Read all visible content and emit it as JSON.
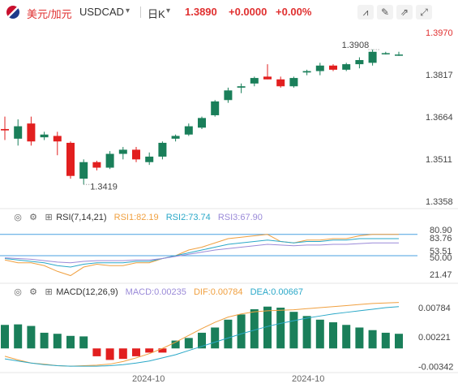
{
  "header": {
    "symbol_cn": "美元/加元",
    "symbol_en": "USDCAD",
    "timeframe": "日K",
    "price": "1.3890",
    "change": "+0.0000",
    "change_pct": "+0.00%",
    "tools": [
      "chart-type-icon",
      "draw-icon",
      "indicator-icon",
      "fullscreen-icon"
    ]
  },
  "chart_data": [
    {
      "type": "candlestick",
      "title": "USDCAD",
      "ylim": [
        1.3358,
        1.397
      ],
      "yticks": [
        "1.3970",
        "1.3817",
        "1.3664",
        "1.3511",
        "1.3358"
      ],
      "annotations": [
        "1.3908",
        "1.3419"
      ],
      "xticks": [
        "2024-10",
        "2024-10"
      ],
      "up_color": "#1a7f5a",
      "down_color": "#e21f1f",
      "candles": [
        {
          "o": 1.362,
          "h": 1.3665,
          "l": 1.358,
          "c": 1.3615,
          "u": false
        },
        {
          "o": 1.3585,
          "h": 1.3655,
          "l": 1.356,
          "c": 1.363,
          "u": true
        },
        {
          "o": 1.364,
          "h": 1.3665,
          "l": 1.356,
          "c": 1.3575,
          "u": false
        },
        {
          "o": 1.359,
          "h": 1.361,
          "l": 1.358,
          "c": 1.36,
          "u": true
        },
        {
          "o": 1.3595,
          "h": 1.361,
          "l": 1.3525,
          "c": 1.3575,
          "u": false
        },
        {
          "o": 1.357,
          "h": 1.3575,
          "l": 1.344,
          "c": 1.345,
          "u": false
        },
        {
          "o": 1.344,
          "h": 1.351,
          "l": 1.3419,
          "c": 1.35,
          "u": true
        },
        {
          "o": 1.35,
          "h": 1.3505,
          "l": 1.347,
          "c": 1.348,
          "u": false
        },
        {
          "o": 1.348,
          "h": 1.354,
          "l": 1.3475,
          "c": 1.353,
          "u": true
        },
        {
          "o": 1.353,
          "h": 1.3555,
          "l": 1.351,
          "c": 1.3545,
          "u": true
        },
        {
          "o": 1.3545,
          "h": 1.3555,
          "l": 1.35,
          "c": 1.351,
          "u": false
        },
        {
          "o": 1.35,
          "h": 1.3535,
          "l": 1.349,
          "c": 1.352,
          "u": true
        },
        {
          "o": 1.352,
          "h": 1.3575,
          "l": 1.351,
          "c": 1.357,
          "u": true
        },
        {
          "o": 1.3585,
          "h": 1.36,
          "l": 1.3575,
          "c": 1.3595,
          "u": true
        },
        {
          "o": 1.36,
          "h": 1.364,
          "l": 1.3595,
          "c": 1.363,
          "u": true
        },
        {
          "o": 1.3625,
          "h": 1.3665,
          "l": 1.362,
          "c": 1.366,
          "u": true
        },
        {
          "o": 1.367,
          "h": 1.3725,
          "l": 1.3665,
          "c": 1.372,
          "u": true
        },
        {
          "o": 1.3725,
          "h": 1.377,
          "l": 1.3715,
          "c": 1.376,
          "u": true
        },
        {
          "o": 1.377,
          "h": 1.3785,
          "l": 1.375,
          "c": 1.3775,
          "u": true
        },
        {
          "o": 1.3785,
          "h": 1.381,
          "l": 1.3775,
          "c": 1.3805,
          "u": true
        },
        {
          "o": 1.381,
          "h": 1.3855,
          "l": 1.38,
          "c": 1.38,
          "u": false
        },
        {
          "o": 1.38,
          "h": 1.381,
          "l": 1.377,
          "c": 1.3775,
          "u": false
        },
        {
          "o": 1.3775,
          "h": 1.381,
          "l": 1.377,
          "c": 1.3805,
          "u": true
        },
        {
          "o": 1.3825,
          "h": 1.3835,
          "l": 1.3815,
          "c": 1.383,
          "u": true
        },
        {
          "o": 1.383,
          "h": 1.386,
          "l": 1.3815,
          "c": 1.385,
          "u": true
        },
        {
          "o": 1.385,
          "h": 1.3855,
          "l": 1.383,
          "c": 1.3835,
          "u": false
        },
        {
          "o": 1.3835,
          "h": 1.386,
          "l": 1.383,
          "c": 1.3855,
          "u": true
        },
        {
          "o": 1.3855,
          "h": 1.388,
          "l": 1.384,
          "c": 1.387,
          "u": true
        },
        {
          "o": 1.386,
          "h": 1.3908,
          "l": 1.385,
          "c": 1.39,
          "u": true
        },
        {
          "o": 1.3895,
          "h": 1.39,
          "l": 1.389,
          "c": 1.3895,
          "u": true
        },
        {
          "o": 1.389,
          "h": 1.39,
          "l": 1.3885,
          "c": 1.389,
          "u": true
        }
      ]
    },
    {
      "type": "line",
      "title": "RSI(7,14,21)",
      "ylim": [
        21.47,
        80.9
      ],
      "yticks": [
        "80.90",
        "83.76",
        "53.51",
        "50.00",
        "21.47"
      ],
      "series": [
        {
          "name": "RSI1:82.19",
          "color": "#f0a040",
          "values": [
            44,
            40,
            40,
            36,
            28,
            22,
            34,
            38,
            36,
            36,
            40,
            40,
            46,
            50,
            58,
            62,
            68,
            74,
            76,
            78,
            80,
            70,
            68,
            72,
            72,
            74,
            74,
            78,
            80,
            80,
            80
          ]
        },
        {
          "name": "RSI2:73.74",
          "color": "#2aa8c8",
          "values": [
            46,
            44,
            42,
            40,
            36,
            34,
            38,
            40,
            40,
            40,
            42,
            42,
            46,
            50,
            54,
            58,
            62,
            66,
            68,
            70,
            72,
            70,
            68,
            70,
            70,
            72,
            72,
            74,
            74,
            74,
            74
          ]
        },
        {
          "name": "RSI3:67.90",
          "color": "#9a8ad8",
          "values": [
            47,
            46,
            45,
            43,
            41,
            40,
            42,
            43,
            43,
            43,
            44,
            44,
            46,
            49,
            52,
            55,
            58,
            60,
            62,
            64,
            66,
            65,
            64,
            65,
            65,
            66,
            66,
            67,
            68,
            68,
            68
          ]
        }
      ],
      "ref_lines": [
        80,
        50
      ]
    },
    {
      "type": "bar",
      "title": "MACD(12,26,9)",
      "ylim": [
        -0.00342,
        0.00784
      ],
      "yticks": [
        "0.00784",
        "0.00221",
        "-0.00342"
      ],
      "series": [
        {
          "name": "MACD:0.00235",
          "color": "#1a7f5a",
          "values": [
            0.0045,
            0.0046,
            0.0043,
            0.003,
            0.0028,
            0.0024,
            0.0023,
            -0.0015,
            -0.0022,
            -0.002,
            -0.0015,
            -0.0008,
            -0.0008,
            0.0015,
            0.002,
            0.003,
            0.004,
            0.0055,
            0.0065,
            0.0075,
            0.008,
            0.0078,
            0.007,
            0.0062,
            0.0055,
            0.005,
            0.0045,
            0.004,
            0.0035,
            0.003,
            0.0028
          ]
        },
        {
          "name": "DIF:0.00784",
          "color": "#f0a040",
          "values": [
            -0.0015,
            -0.0022,
            -0.0028,
            -0.003,
            -0.0033,
            -0.0034,
            -0.0033,
            -0.0032,
            -0.003,
            -0.0025,
            -0.0018,
            -0.001,
            0.0,
            0.0012,
            0.0025,
            0.0038,
            0.005,
            0.006,
            0.0066,
            0.007,
            0.0072,
            0.0073,
            0.0074,
            0.0076,
            0.0078,
            0.008,
            0.0082,
            0.0084,
            0.0086,
            0.0087,
            0.0088
          ]
        },
        {
          "name": "DEA:0.00667",
          "color": "#2aa8c8",
          "values": [
            -0.002,
            -0.0024,
            -0.0028,
            -0.0031,
            -0.0033,
            -0.0034,
            -0.0034,
            -0.0034,
            -0.0033,
            -0.0031,
            -0.0028,
            -0.0024,
            -0.0018,
            -0.0012,
            -0.0004,
            0.0004,
            0.0012,
            0.002,
            0.0028,
            0.0035,
            0.0042,
            0.0048,
            0.0053,
            0.0058,
            0.0062,
            0.0066,
            0.0069,
            0.0072,
            0.0075,
            0.0078,
            0.008
          ]
        }
      ]
    }
  ]
}
